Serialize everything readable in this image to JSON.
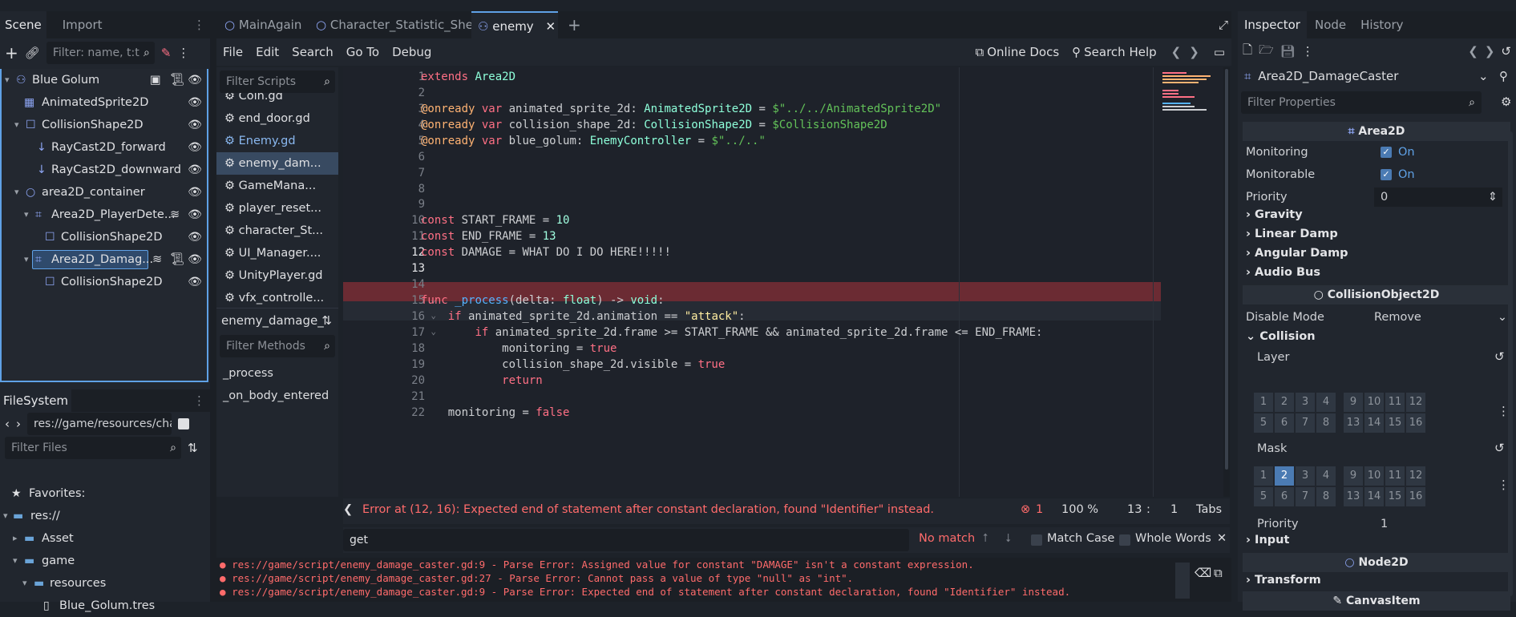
{
  "scene_dock": {
    "tabs": [
      "Scene",
      "Import"
    ],
    "filter_placeholder": "Filter: name, t:t",
    "tree": [
      {
        "label": "Blue Golum",
        "icon": "node-tree-icon"
      },
      {
        "label": "AnimatedSprite2D",
        "icon": "animated-sprite-icon"
      },
      {
        "label": "CollisionShape2D",
        "icon": "collision-shape-icon"
      },
      {
        "label": "RayCast2D_forward",
        "icon": "raycast-icon"
      },
      {
        "label": "RayCast2D_downward",
        "icon": "raycast-icon"
      },
      {
        "label": "area2D_container",
        "icon": "node2d-icon"
      },
      {
        "label": "Area2D_PlayerDete...",
        "icon": "area2d-icon"
      },
      {
        "label": "CollisionShape2D",
        "icon": "collision-shape-icon"
      },
      {
        "label": "Area2D_Damag...",
        "icon": "area2d-icon"
      },
      {
        "label": "CollisionShape2D",
        "icon": "collision-shape-icon"
      }
    ]
  },
  "filesystem": {
    "tab": "FileSystem",
    "path": "res://game/resources/char",
    "filter_placeholder": "Filter Files",
    "items": [
      "Favorites:",
      "res://",
      "Asset",
      "game",
      "resources",
      "Blue_Golum.tres"
    ]
  },
  "editor_tabs": [
    "MainAgain",
    "Character_Statistic_Sheet",
    "enemy"
  ],
  "menu": [
    "File",
    "Edit",
    "Search",
    "Go To",
    "Debug"
  ],
  "toolbar": {
    "online_docs": "Online Docs",
    "search_help": "Search Help"
  },
  "scripts": {
    "filter_placeholder": "Filter Scripts",
    "items": [
      "Coin.gd",
      "end_door.gd",
      "Enemy.gd",
      "enemy_dam...",
      "GameMana...",
      "player_reset...",
      "character_St...",
      "UI_Manager....",
      "UnityPlayer.gd",
      "vfx_controlle..."
    ],
    "current": "enemy_damage_",
    "methods_placeholder": "Filter Methods",
    "methods": [
      "_process",
      "_on_body_entered"
    ]
  },
  "code": {
    "line_numbers": [
      "1",
      "2",
      "3",
      "4",
      "5",
      "6",
      "7",
      "8",
      "9",
      "10",
      "11",
      "12",
      "13",
      "14",
      "15",
      "16",
      "17",
      "18",
      "19",
      "20",
      "21",
      "22"
    ],
    "error": "Error at (12, 16): Expected end of statement after constant declaration, found \"Identifier\" instead.",
    "error_count": "1",
    "zoom": "100 %",
    "position_line": "13",
    "position_col": "1",
    "indent": "Tabs"
  },
  "find": {
    "query": "get",
    "status": "No match",
    "match_case": "Match Case",
    "whole_words": "Whole Words"
  },
  "output": [
    "res://game/script/enemy_damage_caster.gd:9 - Parse Error: Assigned value for constant \"DAMAGE\" isn't a constant expression.",
    "res://game/script/enemy_damage_caster.gd:27 - Parse Error: Cannot pass a value of type \"null\" as \"int\".",
    "res://game/script/enemy_damage_caster.gd:9 - Parse Error: Expected end of statement after constant declaration, found \"Identifier\" instead."
  ],
  "inspector": {
    "tabs": [
      "Inspector",
      "Node",
      "History"
    ],
    "object": "Area2D_DamageCaster",
    "filter_placeholder": "Filter Properties",
    "area2d": "Area2D",
    "monitoring": "Monitoring",
    "monitoring_val": "On",
    "monitorable": "Monitorable",
    "monitorable_val": "On",
    "priority": "Priority",
    "priority_val": "0",
    "gravity": "Gravity",
    "linear_damp": "Linear Damp",
    "angular_damp": "Angular Damp",
    "audio_bus": "Audio Bus",
    "collision_object": "CollisionObject2D",
    "disable_mode": "Disable Mode",
    "disable_mode_val": "Remove",
    "collision": "Collision",
    "layer": "Layer",
    "mask": "Mask",
    "bits_row1": [
      "1",
      "2",
      "3",
      "4",
      "9",
      "10",
      "11",
      "12"
    ],
    "bits_row2": [
      "5",
      "6",
      "7",
      "8",
      "13",
      "14",
      "15",
      "16"
    ],
    "mask_active": "2",
    "priority2_val": "1",
    "input": "Input",
    "node2d": "Node2D",
    "transform": "Transform",
    "canvas_item": "CanvasItem"
  }
}
